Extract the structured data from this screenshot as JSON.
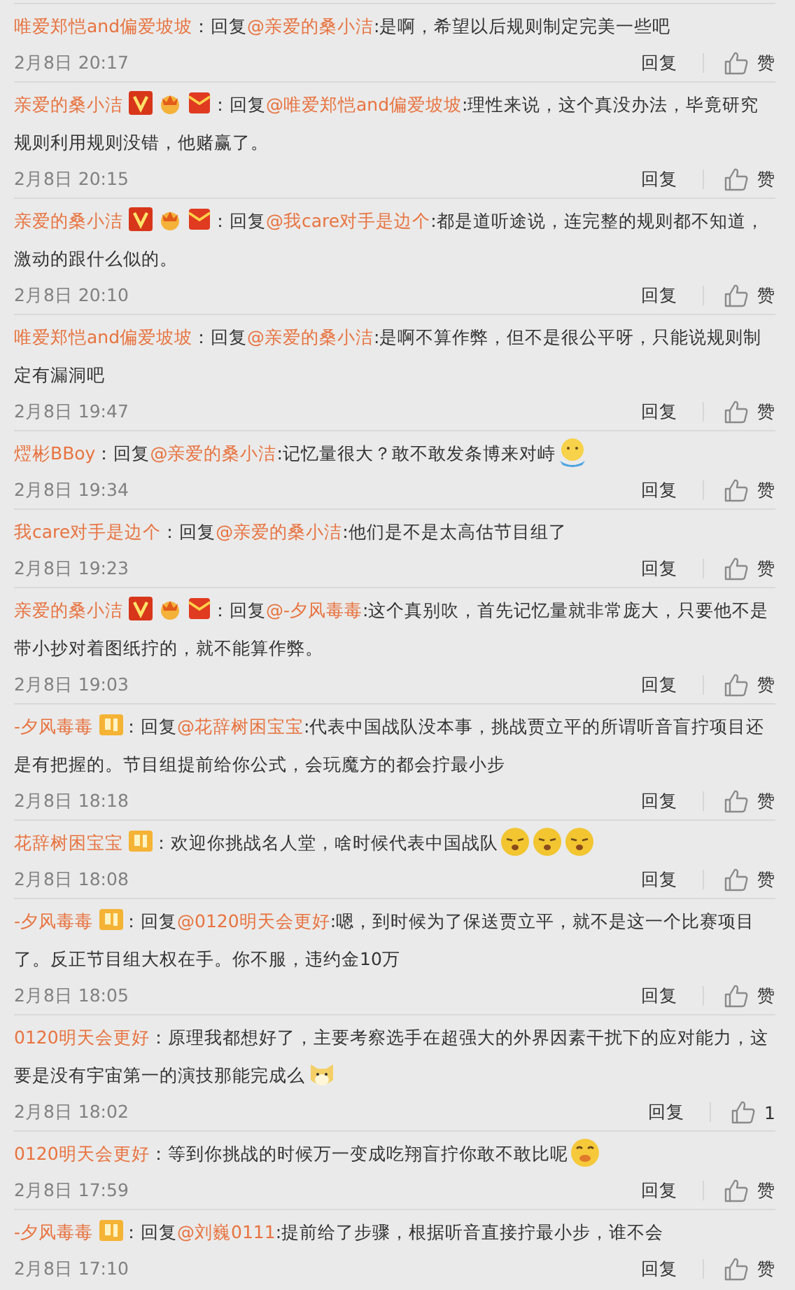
{
  "comments": [
    {
      "user": "唯爱郑恺and偏爱坡坡",
      "separator": "：",
      "reply_prefix": "回复",
      "mention": "@亲爱的桑小洁",
      "text": ":是啊，希望以后规则制定完美一些吧",
      "time": "2月8日 20:17",
      "reply_label": "回复",
      "like_label": "赞"
    },
    {
      "user": "亲爱的桑小洁",
      "badges": [
        {
          "kind": "verified"
        },
        {
          "kind": "crown"
        },
        {
          "kind": "envelope"
        }
      ],
      "separator": "：",
      "reply_prefix": "回复",
      "mention": "@唯爱郑恺and偏爱坡坡",
      "text": ":理性来说，这个真没办法，毕竟研究规则利用规则没错，他赌赢了。",
      "time": "2月8日 20:15",
      "reply_label": "回复",
      "like_label": "赞"
    },
    {
      "user": "亲爱的桑小洁",
      "badges": [
        {
          "kind": "verified"
        },
        {
          "kind": "crown"
        },
        {
          "kind": "envelope"
        }
      ],
      "separator": "：",
      "reply_prefix": "回复",
      "mention": "@我care对手是边个",
      "text": ":都是道听途说，连完整的规则都不知道，激动的跟什么似的。",
      "time": "2月8日 20:10",
      "reply_label": "回复",
      "like_label": "赞"
    },
    {
      "user": "唯爱郑恺and偏爱坡坡",
      "separator": "：",
      "reply_prefix": "回复",
      "mention": "@亲爱的桑小洁",
      "text": ":是啊不算作弊，但不是很公平呀，只能说规则制定有漏洞吧",
      "time": "2月8日 19:47",
      "reply_label": "回复",
      "like_label": "赞"
    },
    {
      "user": "熤彬BBoy",
      "separator": "：",
      "reply_prefix": "回复",
      "mention": "@亲爱的桑小洁",
      "text": ":记忆量很大？敢不敢发条博来对峙",
      "emojis": [
        {
          "kind": "thinking"
        }
      ],
      "time": "2月8日 19:34",
      "reply_label": "回复",
      "like_label": "赞"
    },
    {
      "user": "我care对手是边个",
      "separator": "：",
      "reply_prefix": "回复",
      "mention": "@亲爱的桑小洁",
      "text": ":他们是不是太高估节目组了",
      "time": "2月8日 19:23",
      "reply_label": "回复",
      "like_label": "赞"
    },
    {
      "user": "亲爱的桑小洁",
      "badges": [
        {
          "kind": "verified"
        },
        {
          "kind": "crown"
        },
        {
          "kind": "envelope"
        }
      ],
      "separator": "：",
      "reply_prefix": "回复",
      "mention": "@-夕风毒毒",
      "text": ":这个真别吹，首先记忆量就非常庞大，只要他不是带小抄对着图纸拧的，就不能算作弊。",
      "time": "2月8日 19:03",
      "reply_label": "回复",
      "like_label": "赞"
    },
    {
      "user": "-夕风毒毒",
      "badges": [
        {
          "kind": "fan"
        }
      ],
      "separator": "：",
      "reply_prefix": "回复",
      "mention": "@花辞树困宝宝",
      "text": ":代表中国战队没本事，挑战贾立平的所谓听音盲拧项目还是有把握的。节目组提前给你公式，会玩魔方的都会拧最小步",
      "time": "2月8日 18:18",
      "reply_label": "回复",
      "like_label": "赞"
    },
    {
      "user": "花辞树困宝宝",
      "badges": [
        {
          "kind": "fan"
        }
      ],
      "separator": "：",
      "text": "欢迎你挑战名人堂，啥时候代表中国战队",
      "emojis": [
        {
          "kind": "sleepy"
        },
        {
          "kind": "sleepy"
        },
        {
          "kind": "sleepy"
        }
      ],
      "time": "2月8日 18:08",
      "reply_label": "回复",
      "like_label": "赞"
    },
    {
      "user": "-夕风毒毒",
      "badges": [
        {
          "kind": "fan"
        }
      ],
      "separator": "：",
      "reply_prefix": "回复",
      "mention": "@0120明天会更好",
      "text": ":嗯，到时候为了保送贾立平，就不是这一个比赛项目了。反正节目组大权在手。你不服，违约金10万",
      "time": "2月8日 18:05",
      "reply_label": "回复",
      "like_label": "赞"
    },
    {
      "user": "0120明天会更好",
      "separator": "：",
      "text": "原理我都想好了，主要考察选手在超强大的外界因素干扰下的应对能力，这要是没有宇宙第一的演技那能完成么",
      "emojis": [
        {
          "kind": "cat"
        }
      ],
      "time": "2月8日 18:02",
      "reply_label": "回复",
      "like_label": "1"
    },
    {
      "user": "0120明天会更好",
      "separator": "：",
      "text": "等到你挑战的时候万一变成吃翔盲拧你敢不敢比呢",
      "emojis": [
        {
          "kind": "giggle"
        }
      ],
      "time": "2月8日 17:59",
      "reply_label": "回复",
      "like_label": "赞"
    },
    {
      "user": "-夕风毒毒",
      "badges": [
        {
          "kind": "fan"
        }
      ],
      "separator": "：",
      "reply_prefix": "回复",
      "mention": "@刘巍0111",
      "text": ":提前给了步骤，根据听音直接拧最小步，谁不会",
      "time": "2月8日 17:10",
      "reply_label": "回复",
      "like_label": "赞"
    }
  ]
}
